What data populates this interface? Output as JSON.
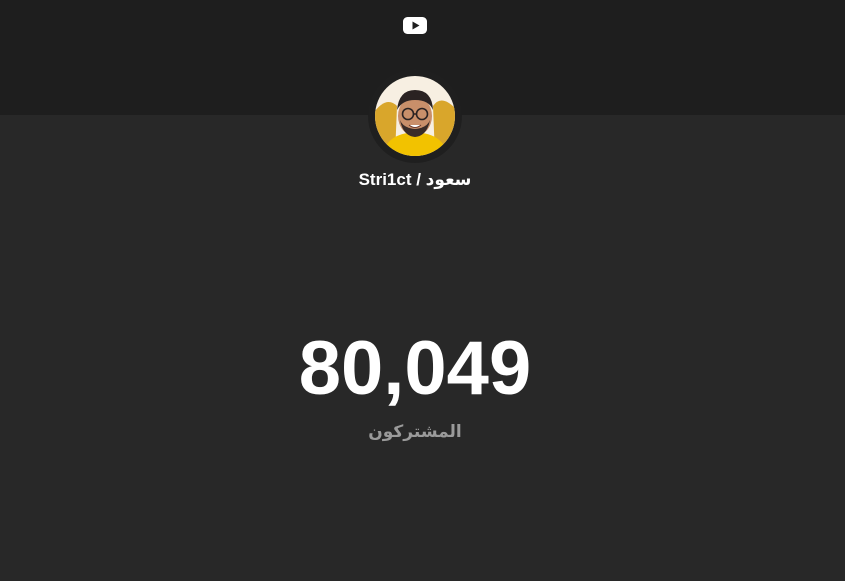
{
  "channel": {
    "name": "سعود / Stri1ct",
    "avatar_icon": "channel-avatar"
  },
  "header": {
    "logo_icon": "youtube-icon"
  },
  "stats": {
    "subscriber_count": "80,049",
    "subscriber_label": "المشتركون"
  },
  "colors": {
    "background": "#282828",
    "header_band": "#1e1e1e",
    "text": "#ffffff",
    "label": "#9a9a9a",
    "avatar_accent": "#f2c200"
  }
}
